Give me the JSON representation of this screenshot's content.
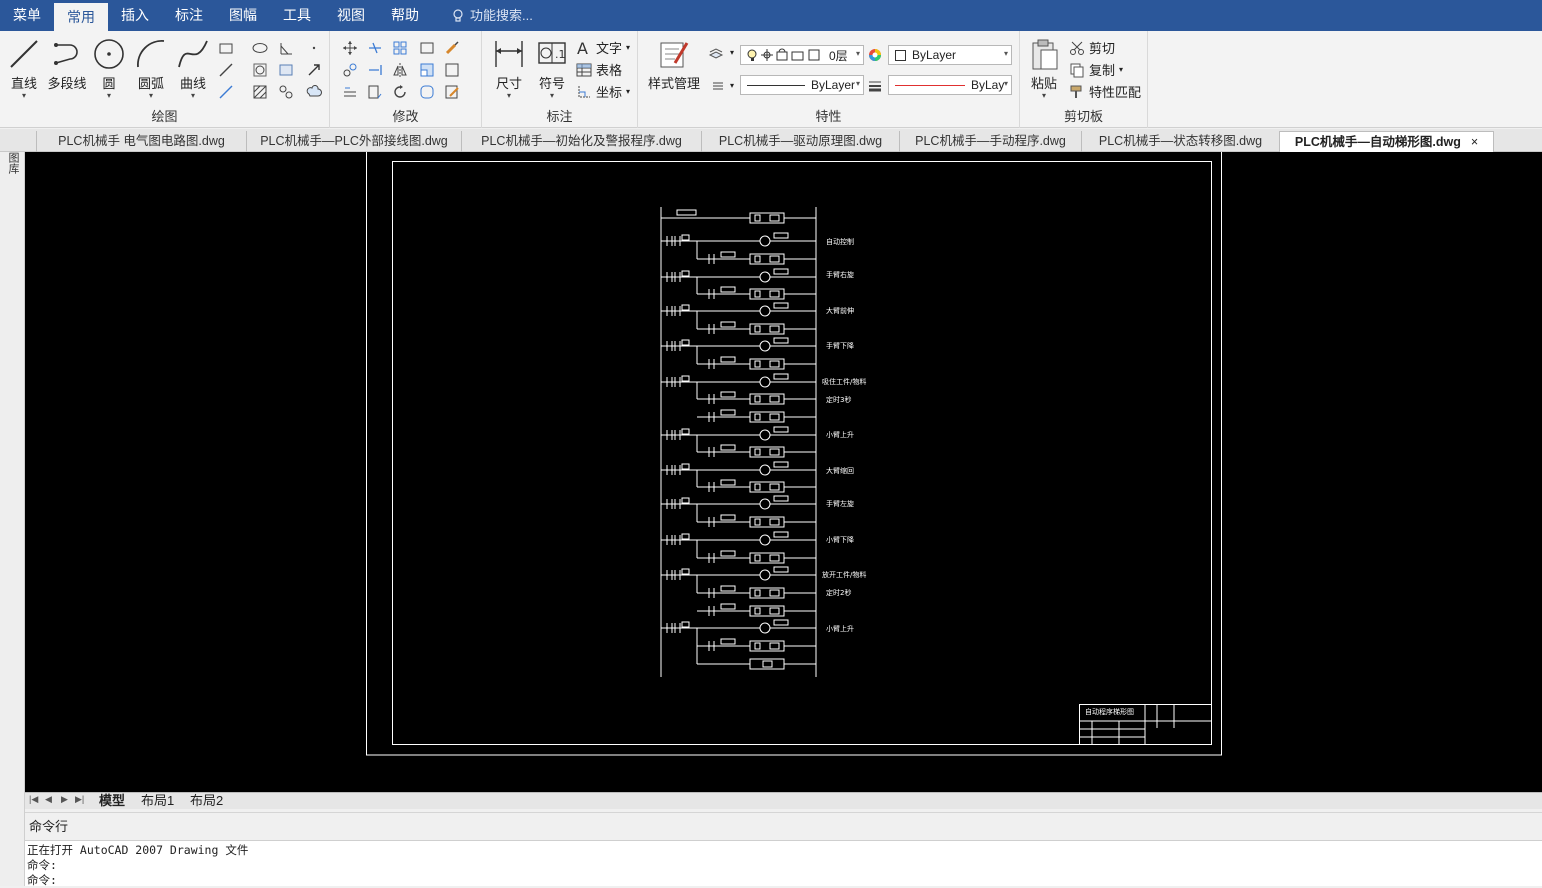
{
  "menu": {
    "items": [
      "菜单",
      "常用",
      "插入",
      "标注",
      "图幅",
      "工具",
      "视图",
      "帮助"
    ],
    "active_index": 1,
    "search_placeholder": "功能搜索..."
  },
  "ribbon": {
    "draw": {
      "label": "绘图",
      "line": "直线",
      "polyline": "多段线",
      "circle": "圆",
      "arc": "圆弧",
      "curve": "曲线"
    },
    "modify": {
      "label": "修改"
    },
    "dim": {
      "label": "标注",
      "size": "尺寸",
      "symbol": "符号",
      "text": "文字",
      "table": "表格",
      "coord": "坐标"
    },
    "props": {
      "label": "特性",
      "style_mgr": "样式管理",
      "layer": "0层",
      "color": "ByLayer",
      "linetype": "ByLayer",
      "lineweight": "ByLay"
    },
    "clip": {
      "label": "剪切板",
      "paste": "粘贴",
      "cut": "剪切",
      "copy": "复制",
      "match": "特性匹配"
    }
  },
  "file_tabs": [
    "PLC机械手 电气图电路图.dwg",
    "PLC机械手—PLC外部接线图.dwg",
    "PLC机械手—初始化及警报程序.dwg",
    "PLC机械手—驱动原理图.dwg",
    "PLC机械手—手动程序.dwg",
    "PLC机械手—状态转移图.dwg",
    "PLC机械手—自动梯形图.dwg"
  ],
  "active_file_tab": 6,
  "close_glyph": "×",
  "left_strip_label": "图库",
  "drawing": {
    "rung_labels": [
      "自动控制",
      "手臂右旋",
      "大臂前伸",
      "手臂下降",
      "吸住工件/物料",
      "定时3秒",
      "小臂上升",
      "大臂缩回",
      "手臂左旋",
      "小臂下降",
      "放开工件/物料",
      "定时2秒",
      "小臂上升"
    ],
    "title_block": "自动程序梯形图"
  },
  "layout_tabs": [
    "模型",
    "布局1",
    "布局2"
  ],
  "command": {
    "header": "命令行",
    "lines": [
      "正在打开 AutoCAD 2007 Drawing 文件",
      "命令:",
      "命令:"
    ]
  }
}
